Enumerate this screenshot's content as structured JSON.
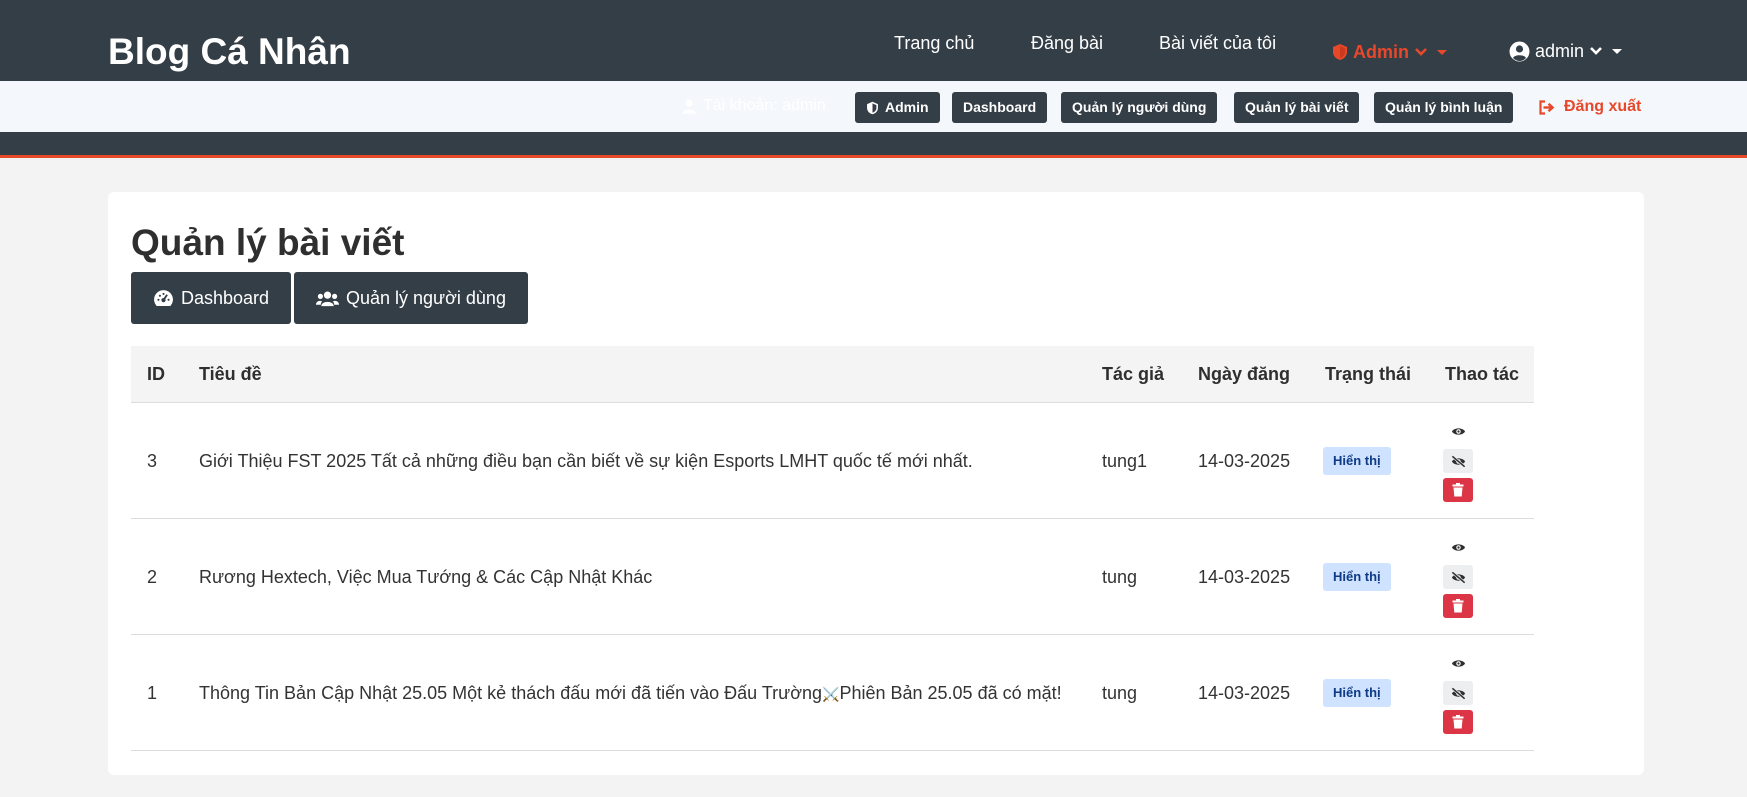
{
  "navbar": {
    "brand": "Blog Cá Nhân",
    "links": [
      "Trang chủ",
      "Đăng bài",
      "Bài viết của tôi"
    ],
    "admin_menu": "Admin",
    "user_menu": "admin",
    "colors": {
      "bg": "#343e47",
      "accent": "#e8482a"
    }
  },
  "subbar": {
    "account_label": "Tài khoản: admin",
    "chips": [
      "Admin",
      "Dashboard",
      "Quản lý người dùng",
      "Quản lý bài viết",
      "Quản lý bình luận"
    ],
    "logout": "Đăng xuất"
  },
  "main": {
    "title": "Quản lý bài viết",
    "buttons": [
      "Dashboard",
      "Quản lý người dùng"
    ],
    "table": {
      "headers": [
        "ID",
        "Tiêu đề",
        "Tác giả",
        "Ngày đăng",
        "Trạng thái",
        "Thao tác"
      ],
      "rows": [
        {
          "id": "3",
          "title": "Giới Thiệu FST 2025 Tất cả những điều bạn cần biết về sự kiện Esports LMHT quốc tế mới nhất.",
          "author": "tung1",
          "date": "14-03-2025",
          "status": "Hiển thị"
        },
        {
          "id": "2",
          "title": "Rương Hextech, Việc Mua Tướng & Các Cập Nhật Khác",
          "author": "tung",
          "date": "14-03-2025",
          "status": "Hiển thị"
        },
        {
          "id": "1",
          "title_before": "Thông Tin Bản Cập Nhật 25.05 Một kẻ thách đấu mới đã tiến vào Đấu Trường",
          "title_symbol": "⚔️",
          "title_after": "Phiên Bản 25.05 đã có mặt!",
          "author": "tung",
          "date": "14-03-2025",
          "status": "Hiển thị"
        }
      ]
    }
  },
  "icons": {
    "admin": "shield-icon",
    "user": "user-circle-icon",
    "dashboard": "gauge-icon",
    "users": "users-icon",
    "logout": "sign-out-icon",
    "view": "eye-icon",
    "hide": "eye-slash-icon",
    "delete": "trash-icon"
  }
}
